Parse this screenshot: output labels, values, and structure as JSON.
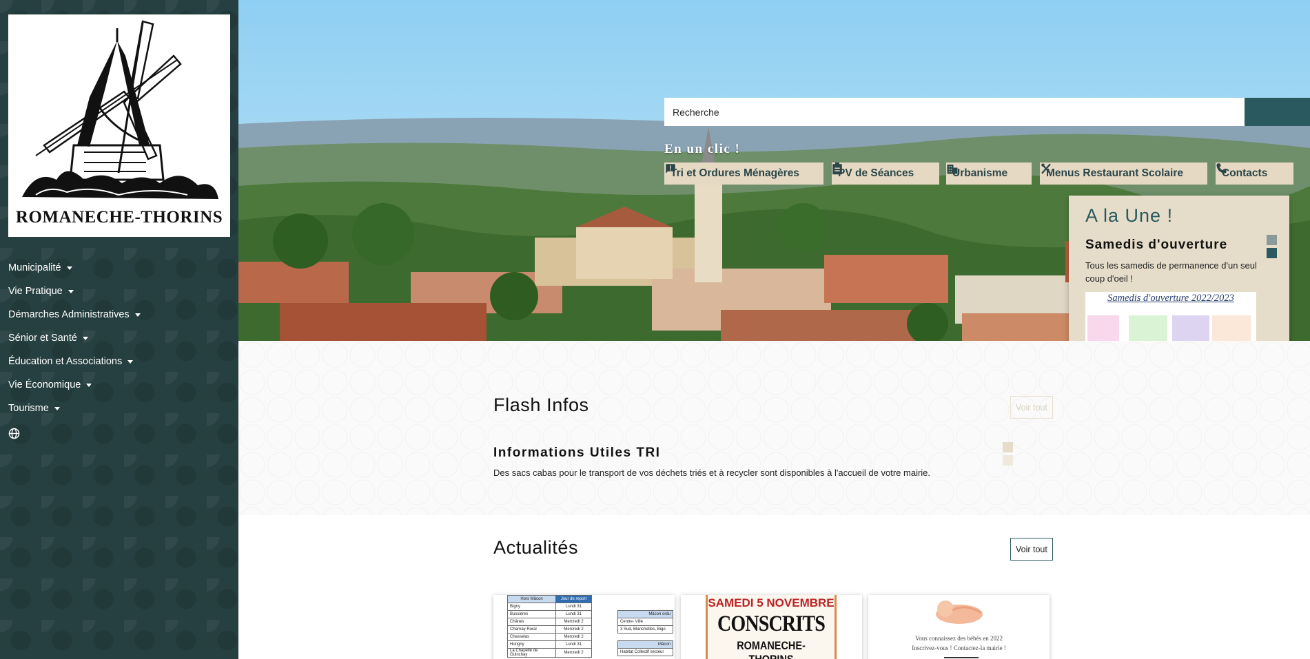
{
  "sidebar": {
    "logo_text": "ROMANECHE-THORINS",
    "nav": [
      "Municipalité",
      "Vie Pratique",
      "Démarches Administratives",
      "Sénior et Santé",
      "Éducation et Associations",
      "Vie Économique",
      "Tourisme"
    ],
    "language_icon": "globe-icon"
  },
  "search": {
    "placeholder": "Recherche",
    "button_icon": "search-icon"
  },
  "quick_links": {
    "title": "En un clic !",
    "items": [
      {
        "label": "Tri et Ordures Ménagères",
        "icon": "feedback-icon"
      },
      {
        "label": "PV de Séances",
        "icon": "clipboard-icon"
      },
      {
        "label": "Urbanisme",
        "icon": "building-icon"
      },
      {
        "label": "Menus Restaurant Scolaire",
        "icon": "utensils-icon"
      },
      {
        "label": "Contacts",
        "icon": "phone-icon"
      }
    ]
  },
  "une": {
    "title": "A la Une !",
    "item_title": "Samedis d'ouverture",
    "item_text": "Tous les samedis de permanence d'un seul coup d'oeil !",
    "image_title": "Samedis d'ouverture 2022/2023"
  },
  "flash": {
    "title": "Flash Infos",
    "voir_tout": "Voir tout",
    "item_title": "Informations Utiles TRI",
    "item_text": "Des sacs cabas pour le transport de vos déchets triés et à recycler sont disponibles à l'accueil de votre mairie."
  },
  "actu": {
    "title": "Actualités",
    "voir_tout": "Voir tout",
    "card1": {
      "col1_header": "Hors Mâcon",
      "col2_header": "Jour de report",
      "rows": [
        [
          "Bigny",
          "Lundi 31"
        ],
        [
          "Bussières",
          "Lundi 31"
        ],
        [
          "Chânes",
          "Mercredi 2"
        ],
        [
          "Charnay Rural",
          "Mercredi 2"
        ],
        [
          "Chasselas",
          "Mercredi 2"
        ],
        [
          "Hurigny",
          "Lundi 31"
        ],
        [
          "La Chapelle de Guinchay",
          "Mercredi 2"
        ]
      ],
      "side_header": "Mâcon ordu",
      "side_rows": [
        "Centre- Ville",
        "3 Sud, Blanchettes, Bigo"
      ],
      "side_header2": "Mâcon",
      "side_row2": "Habitat Collectif secteur"
    },
    "card2": {
      "date": "SAMEDI 5 NOVEMBRE",
      "big": "CONSCRITS",
      "town": "ROMANECHE-THORINS"
    },
    "card3": {
      "line1": "Vous connaissez des bébés en 2022",
      "line2": "Inscrivez-vous ! Contactez-la mairie !"
    }
  }
}
